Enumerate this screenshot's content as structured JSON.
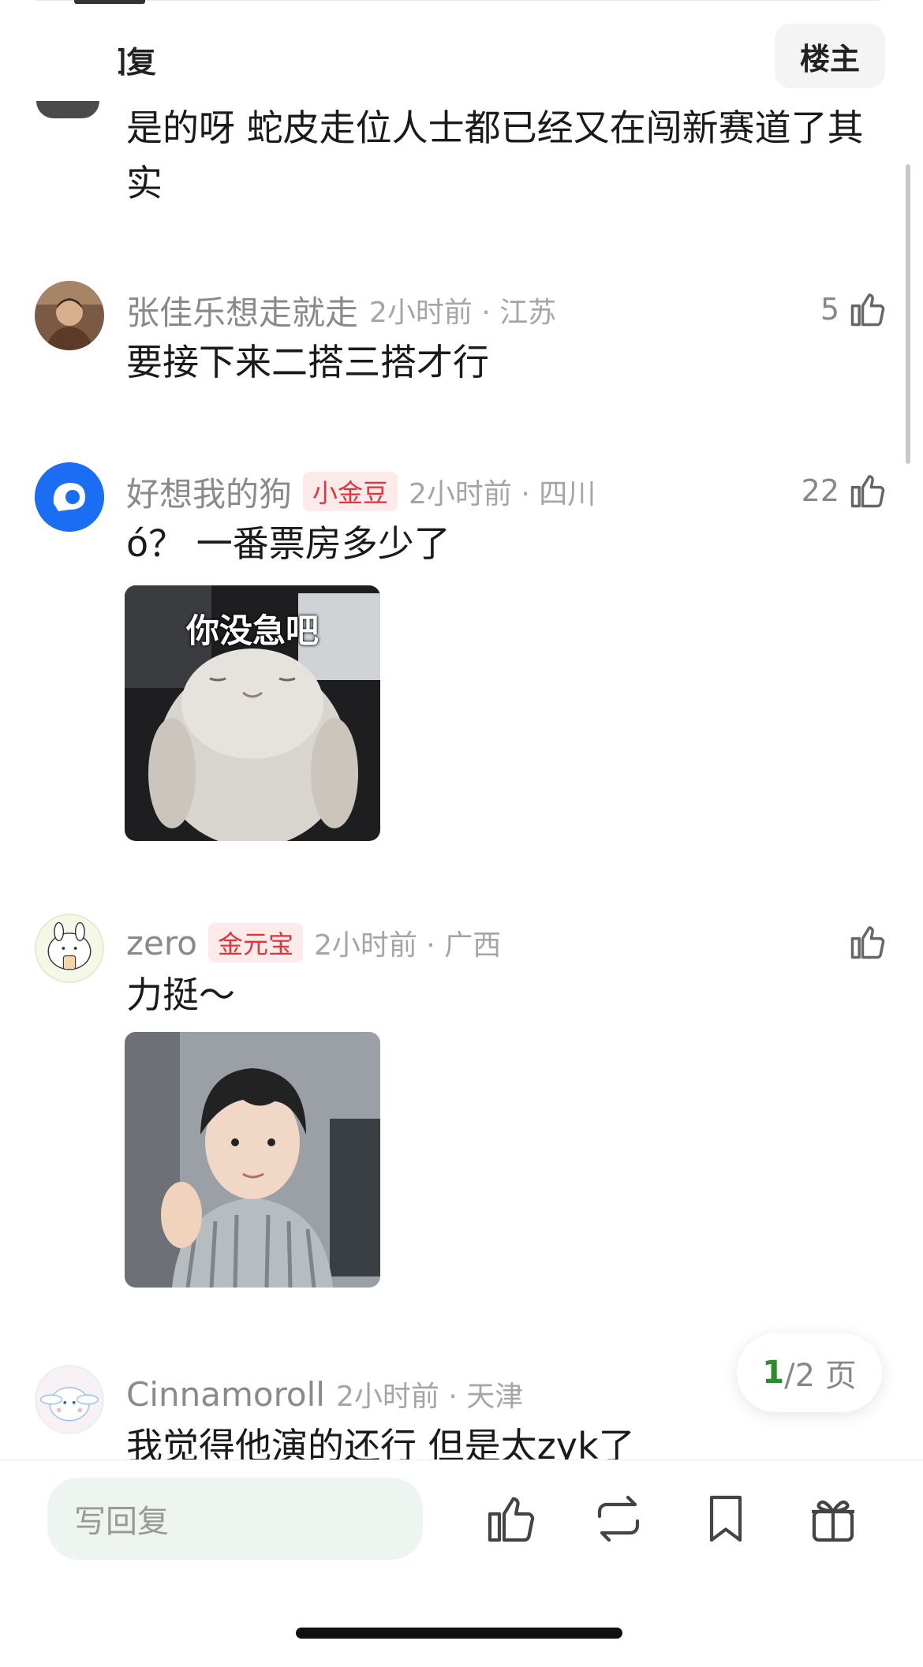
{
  "header": {
    "title": "全部回复",
    "op_button": "楼主"
  },
  "comments": [
    {
      "name": "",
      "badge": "",
      "meta": "",
      "text": "是的呀 蛇皮走位人士都已经又在闯新赛道了其实",
      "likes": ""
    },
    {
      "name": "张佳乐想走就走",
      "badge": "",
      "meta": "2小时前 · 江苏",
      "text": "要接下来二搭三搭才行",
      "likes": "5"
    },
    {
      "name": "好想我的狗",
      "badge": "小金豆",
      "meta": "2小时前 · 四川",
      "text": "ó？ 一番票房多少了",
      "likes": "22",
      "image_caption": "你没急吧"
    },
    {
      "name": "zero",
      "badge": "金元宝",
      "meta": "2小时前 · 广西",
      "text": "力挺～",
      "likes": ""
    },
    {
      "name": "Cinnamoroll",
      "badge": "",
      "meta": "2小时前 · 天津",
      "text": "我觉得他演的还行 但是太zyk了",
      "likes": ""
    }
  ],
  "pagination": {
    "current": "1",
    "sep_total": "/2 页"
  },
  "bottom": {
    "reply_placeholder": "写回复"
  },
  "icons": {
    "like": "thumbs-up-icon",
    "repost": "repost-icon",
    "bookmark": "bookmark-icon",
    "gift": "gift-icon"
  },
  "colors": {
    "badge_text": "#e0353a",
    "badge_bg": "#fdeaea",
    "page_current": "#2e8b2e",
    "reply_bg": "#eef4ef"
  }
}
